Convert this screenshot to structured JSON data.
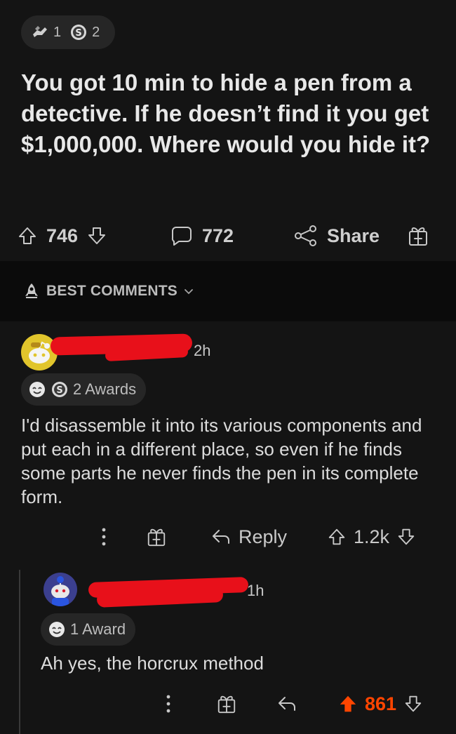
{
  "post": {
    "awards": [
      {
        "icon": "helping-hand-award-icon",
        "count": "1"
      },
      {
        "icon": "silver-award-icon",
        "count": "2"
      }
    ],
    "title": "You got 10 min to hide a pen from a detective. If he doesn’t find it you get $1,000,000. Where would you hide it?",
    "votes": "746",
    "comments": "772",
    "share_label": "Share"
  },
  "sort_bar": {
    "label": "BEST COMMENTS",
    "icon": "rocket-icon"
  },
  "comments": [
    {
      "time": "2h",
      "awards_label": "2 Awards",
      "award_icons": [
        "wholesome-award-icon",
        "silver-award-icon"
      ],
      "body": "I'd disassemble it into its various components and put each in a different place, so even if he finds some parts he never finds the pen in its complete form.",
      "reply_label": "Reply",
      "votes": "1.2k",
      "upvoted": false
    },
    {
      "time": "1h",
      "awards_label": "1 Award",
      "award_icons": [
        "wholesome-award-icon"
      ],
      "body": "Ah yes, the horcrux method",
      "votes": "861",
      "upvoted": true
    }
  ],
  "colors": {
    "background": "#141414",
    "sort_bar_bg": "#0b0b0b",
    "upvote_active": "#ff4500",
    "redaction": "#e8101a",
    "avatar1": "#e1c52c",
    "avatar2": "#3b3f8f"
  }
}
